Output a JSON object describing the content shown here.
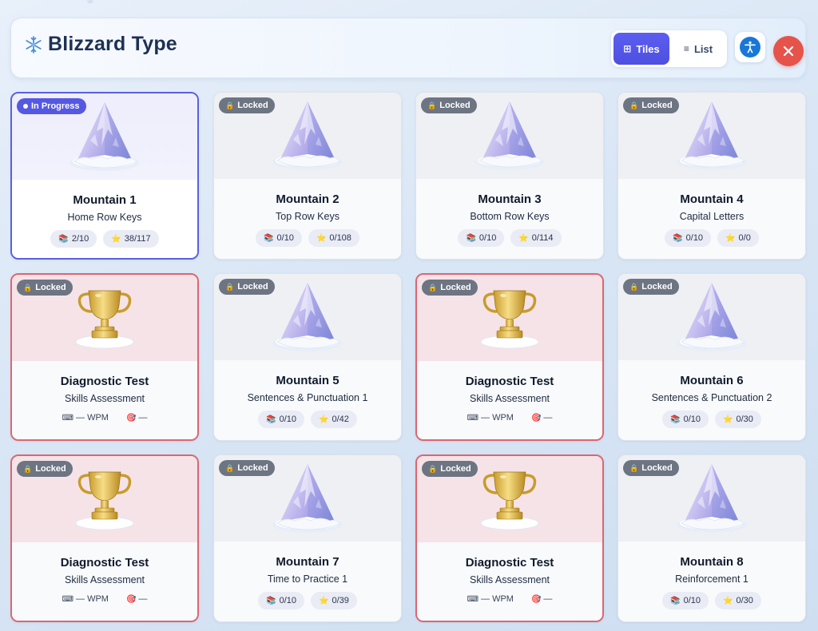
{
  "app": {
    "title": "Blizzard Type"
  },
  "header": {
    "view_tiles_label": "Tiles",
    "view_list_label": "List",
    "active_view": "Tiles"
  },
  "colors": {
    "accent": "#5558e3",
    "locked": "#6d7482",
    "test_border": "#dc6670",
    "close": "#e5534b"
  },
  "cards": [
    {
      "kind": "mountain",
      "badge": "In Progress",
      "title": "Mountain 1",
      "subtitle": "Home Row Keys",
      "lessons": "2/10",
      "stars": "38/117"
    },
    {
      "kind": "mountain",
      "badge": "Locked",
      "title": "Mountain 2",
      "subtitle": "Top Row Keys",
      "lessons": "0/10",
      "stars": "0/108"
    },
    {
      "kind": "mountain",
      "badge": "Locked",
      "title": "Mountain 3",
      "subtitle": "Bottom Row Keys",
      "lessons": "0/10",
      "stars": "0/114"
    },
    {
      "kind": "mountain",
      "badge": "Locked",
      "title": "Mountain 4",
      "subtitle": "Capital Letters",
      "lessons": "0/10",
      "stars": "0/0"
    },
    {
      "kind": "test",
      "badge": "Locked",
      "title": "Diagnostic Test",
      "subtitle": "Skills Assessment",
      "wpm": "— WPM",
      "accuracy": "—"
    },
    {
      "kind": "mountain",
      "badge": "Locked",
      "title": "Mountain 5",
      "subtitle": "Sentences & Punctuation 1",
      "lessons": "0/10",
      "stars": "0/42"
    },
    {
      "kind": "test",
      "badge": "Locked",
      "title": "Diagnostic Test",
      "subtitle": "Skills Assessment",
      "wpm": "— WPM",
      "accuracy": "—"
    },
    {
      "kind": "mountain",
      "badge": "Locked",
      "title": "Mountain 6",
      "subtitle": "Sentences & Punctuation 2",
      "lessons": "0/10",
      "stars": "0/30"
    },
    {
      "kind": "test",
      "badge": "Locked",
      "title": "Diagnostic Test",
      "subtitle": "Skills Assessment",
      "wpm": "— WPM",
      "accuracy": "—"
    },
    {
      "kind": "mountain",
      "badge": "Locked",
      "title": "Mountain 7",
      "subtitle": "Time to Practice 1",
      "lessons": "0/10",
      "stars": "0/39"
    },
    {
      "kind": "test",
      "badge": "Locked",
      "title": "Diagnostic Test",
      "subtitle": "Skills Assessment",
      "wpm": "— WPM",
      "accuracy": "—"
    },
    {
      "kind": "mountain",
      "badge": "Locked",
      "title": "Mountain 8",
      "subtitle": "Reinforcement 1",
      "lessons": "0/10",
      "stars": "0/30"
    }
  ]
}
